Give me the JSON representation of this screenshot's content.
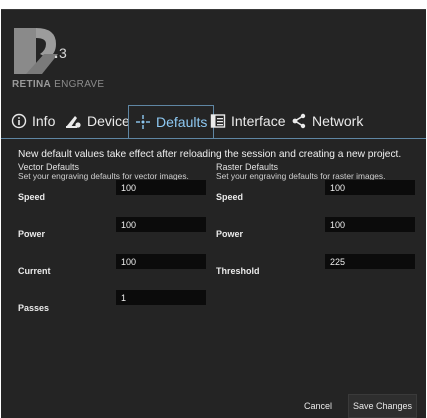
{
  "logo": {
    "mark_sup": "3",
    "brand_bold": "RETINA",
    "brand_light": " ENGRAVE"
  },
  "tabs": [
    {
      "label": "Info",
      "icon": "info-icon"
    },
    {
      "label": "Device",
      "icon": "device-icon"
    },
    {
      "label": "Defaults",
      "icon": "crosshair-icon",
      "active": true
    },
    {
      "label": "Interface",
      "icon": "interface-icon"
    },
    {
      "label": "Network",
      "icon": "share-icon"
    }
  ],
  "notice": "New default values take effect after reloading the session and creating a new project.",
  "vector": {
    "title": "Vector Defaults",
    "subtitle": "Set your engraving defaults for vector images.",
    "speed_label": "Speed",
    "speed": "100",
    "power_label": "Power",
    "power": "100",
    "current_label": "Current",
    "current": "100",
    "passes_label": "Passes",
    "passes": "1"
  },
  "raster": {
    "title": "Raster Defaults",
    "subtitle": "Set your engraving defaults for raster images.",
    "speed_label": "Speed",
    "speed": "100",
    "power_label": "Power",
    "power": "100",
    "threshold_label": "Threshold",
    "threshold": "225"
  },
  "buttons": {
    "cancel": "Cancel",
    "save": "Save Changes"
  },
  "colors": {
    "background": "#242424",
    "accent": "#8ec9f3",
    "field": "#0b0b0b"
  }
}
